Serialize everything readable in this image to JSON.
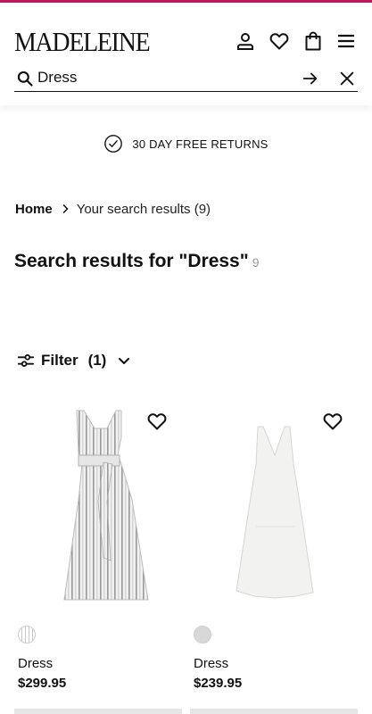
{
  "brand": {
    "logo": "MADELEINE",
    "accent_color": "#c2185b"
  },
  "header": {
    "icons": [
      "account-icon",
      "heart-icon",
      "bag-icon",
      "menu-icon"
    ]
  },
  "search": {
    "value": "Dress",
    "placeholder": "Search",
    "icons": [
      "search-icon",
      "arrow-right-icon",
      "close-icon"
    ]
  },
  "promo": {
    "text": "30 DAY FREE RETURNS",
    "icon": "check-circle-icon"
  },
  "breadcrumb": {
    "home": "Home",
    "current": "Your search results (9)"
  },
  "results": {
    "title": "Search results for \"Dress\"",
    "count": "9"
  },
  "filter": {
    "label": "Filter",
    "count": "(1)"
  },
  "products": [
    {
      "name": "Dress",
      "price": "$299.95",
      "swatch": "striped white/grey",
      "image": "striped wrap maxi dress"
    },
    {
      "name": "Dress",
      "price": "$239.95",
      "swatch": "light grey",
      "image": "white v-neck sleeveless dress"
    }
  ]
}
